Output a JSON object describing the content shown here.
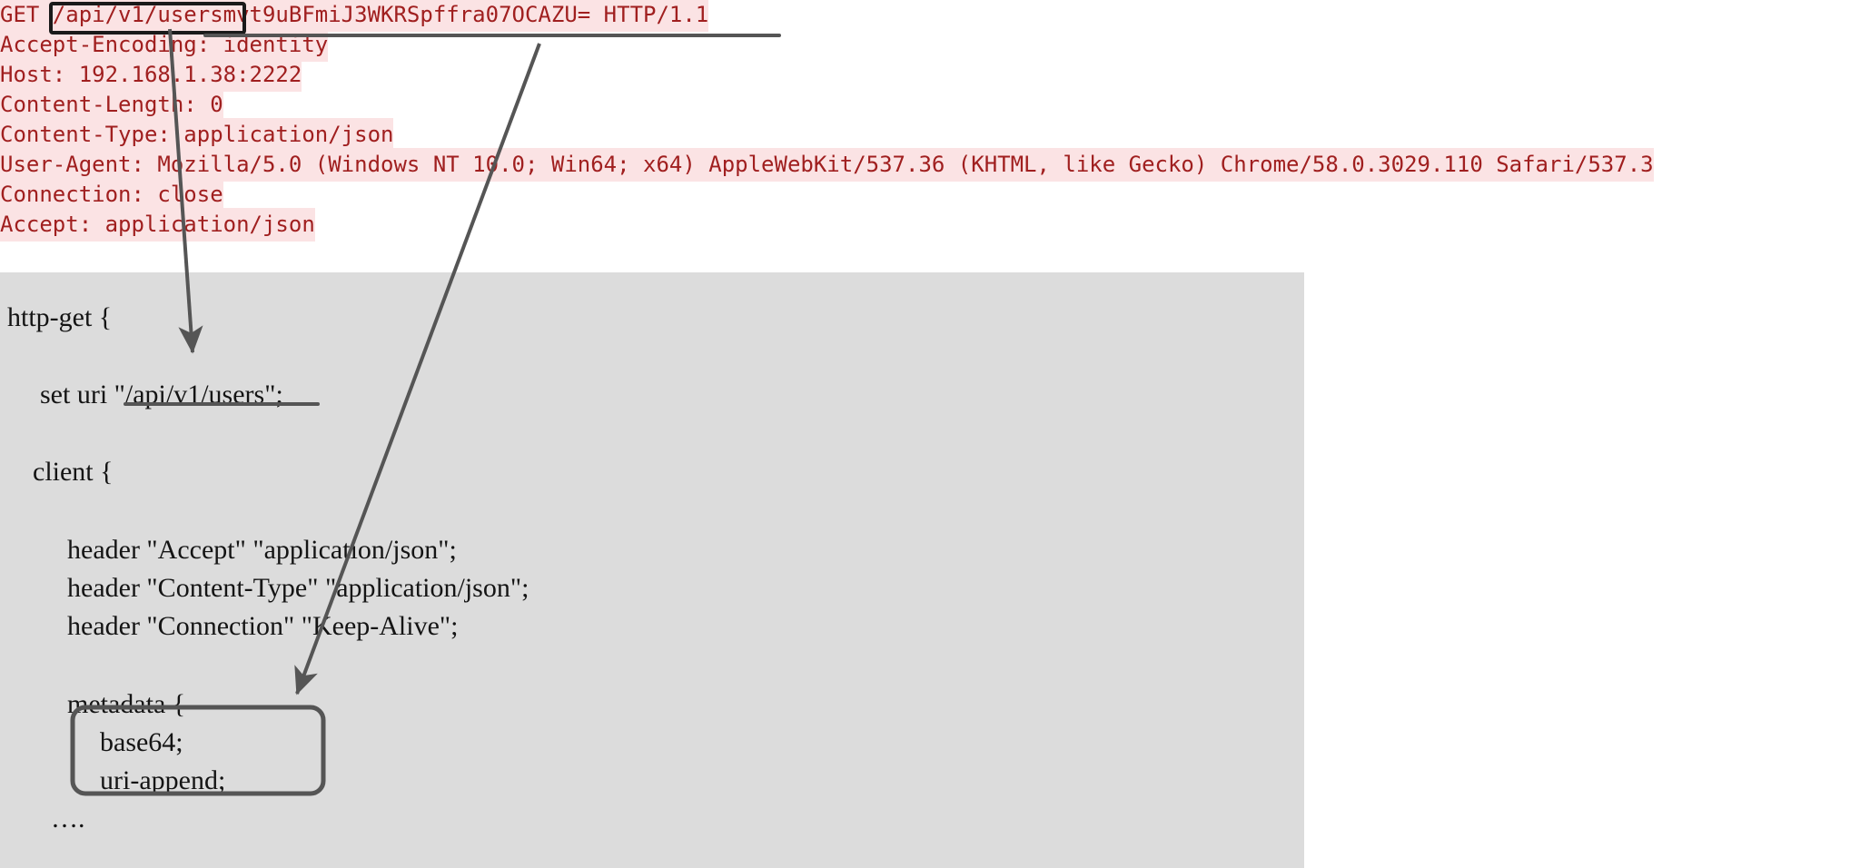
{
  "http_request": {
    "lines": [
      "GET /api/v1/usersmvt9uBFmiJ3WKRSpffra07OCAZU= HTTP/1.1",
      "Accept-Encoding: identity",
      "Host: 192.168.1.38:2222",
      "Content-Length: 0",
      "Content-Type: application/json",
      "User-Agent: Mozilla/5.0 (Windows NT 10.0; Win64; x64) AppleWebKit/537.36 (KHTML, like Gecko) Chrome/58.0.3029.110 Safari/537.3",
      "Connection: close",
      "Accept: application/json"
    ],
    "request_line_parts": {
      "method": "GET ",
      "uri": "/api/v1/user",
      "encoded": "smvt9uBFmiJ3WKRSpffra07OCAZU=",
      "version": " HTTP/1.1"
    },
    "text_color": "#a01f1f",
    "highlight_color": "#fbe3e4"
  },
  "code_block": {
    "background_color": "#dcdcdc",
    "text_color": "#141414",
    "lines": [
      "http-get {",
      "set uri \"/api/v1/users\";",
      "client {",
      "header \"Accept\" \"application/json\";",
      "header \"Content-Type\" \"application/json\";",
      "header \"Connection\" \"Keep-Alive\";",
      "metadata {",
      "base64;",
      "uri-append;",
      "…."
    ],
    "metadata_box_items": [
      "base64;",
      "uri-append;"
    ]
  },
  "annotations": {
    "stroke_color": "#555555",
    "box_color": "#1a1a1a",
    "uri_box_label": "/api/v1/user",
    "metadata_box_label": "base64; uri-append;",
    "arrow_from_uri_to_set_uri": "uri box points at set uri line",
    "arrow_from_base64_to_metadata": "base64 underline points at metadata block"
  }
}
